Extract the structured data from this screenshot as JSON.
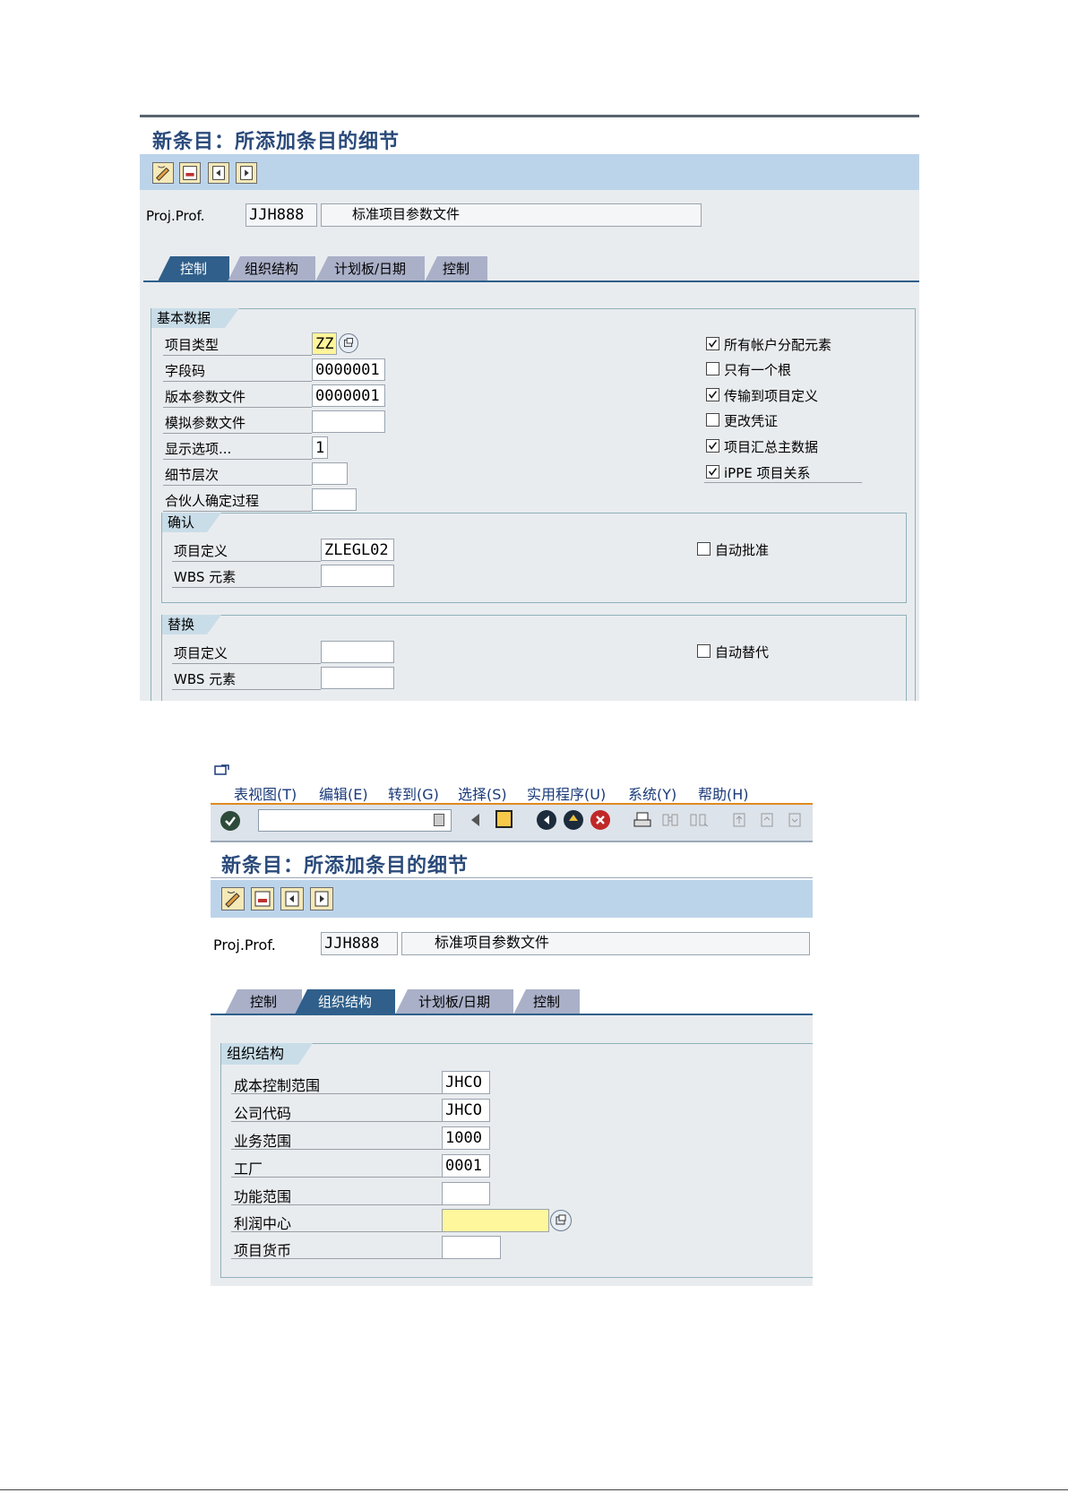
{
  "screen1": {
    "title": "新条目：所添加条目的细节",
    "proj_prof_label": "Proj.Prof.",
    "proj_prof_value": "JJH888",
    "proj_prof_desc": "标准项目参数文件",
    "tabs": [
      "控制",
      "组织结构",
      "计划板/日期",
      "控制"
    ],
    "active_tab": 0,
    "basic_group_title": "基本数据",
    "fields": [
      {
        "label": "项目类型",
        "value": "ZZ"
      },
      {
        "label": "字段码",
        "value": "0000001"
      },
      {
        "label": "版本参数文件",
        "value": "0000001"
      },
      {
        "label": "模拟参数文件",
        "value": ""
      },
      {
        "label": "显示选项...",
        "value": "1"
      },
      {
        "label": "细节层次",
        "value": ""
      },
      {
        "label": "合伙人确定过程",
        "value": ""
      }
    ],
    "checkboxes": [
      {
        "label": "所有帐户分配元素",
        "checked": true
      },
      {
        "label": "只有一个根",
        "checked": false
      },
      {
        "label": "传输到项目定义",
        "checked": true
      },
      {
        "label": "更改凭证",
        "checked": false
      },
      {
        "label": "项目汇总主数据",
        "checked": true
      },
      {
        "label": "iPPE 项目关系",
        "checked": true
      }
    ],
    "confirm_group": {
      "title": "确认",
      "fields": [
        {
          "label": "项目定义",
          "value": "ZLEGL02"
        },
        {
          "label": "WBS 元素",
          "value": ""
        }
      ],
      "checkbox": {
        "label": "自动批准",
        "checked": false
      }
    },
    "replace_group": {
      "title": "替换",
      "fields": [
        {
          "label": "项目定义",
          "value": ""
        },
        {
          "label": "WBS 元素",
          "value": ""
        }
      ],
      "checkbox": {
        "label": "自动替代",
        "checked": false
      }
    }
  },
  "screen2": {
    "menu": [
      "表视图(T)",
      "编辑(E)",
      "转到(G)",
      "选择(S)",
      "实用程序(U)",
      "系统(Y)",
      "帮助(H)"
    ],
    "title": "新条目：所添加条目的细节",
    "proj_prof_label": "Proj.Prof.",
    "proj_prof_value": "JJH888",
    "proj_prof_desc": "标准项目参数文件",
    "tabs": [
      "控制",
      "组织结构",
      "计划板/日期",
      "控制"
    ],
    "active_tab": 1,
    "org_group_title": "组织结构",
    "fields": [
      {
        "label": "成本控制范围",
        "value": "JHCO"
      },
      {
        "label": "公司代码",
        "value": "JHCO"
      },
      {
        "label": "业务范围",
        "value": "1000"
      },
      {
        "label": "工厂",
        "value": "0001"
      },
      {
        "label": "功能范围",
        "value": ""
      },
      {
        "label": "利润中心",
        "value": ""
      },
      {
        "label": "项目货币",
        "value": ""
      }
    ]
  }
}
